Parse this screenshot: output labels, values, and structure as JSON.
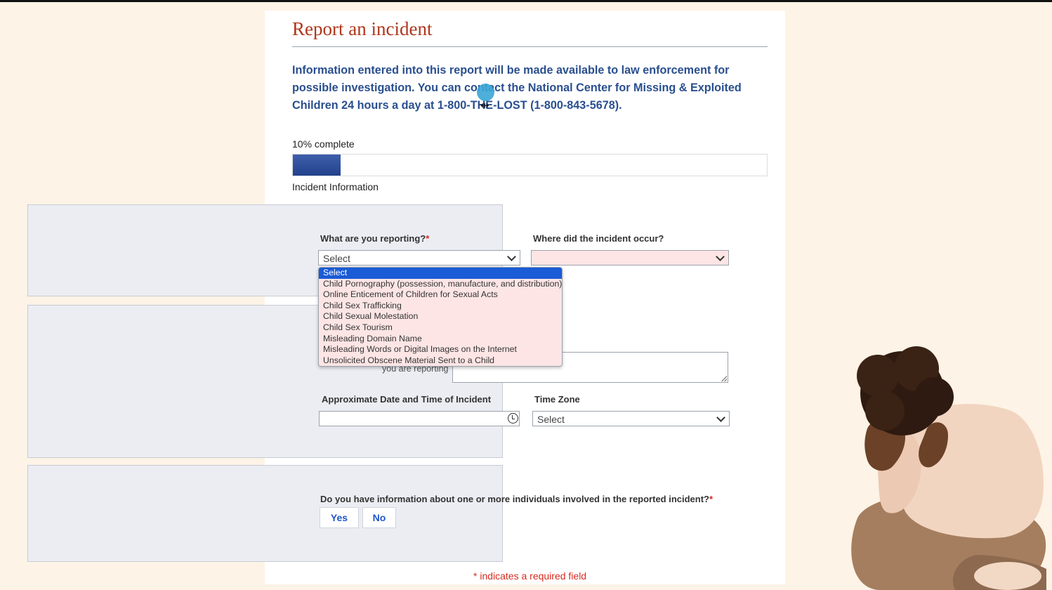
{
  "page": {
    "title": "Report an incident",
    "notice": "Information entered into this report will be made available to law enforcement for possible investigation. You can contact the National Center for Missing & Exploited Children 24 hours a day at 1-800-THE-LOST (1-800-843-5678).",
    "progress_label": "10% complete",
    "progress_percent": 10,
    "section_label": "Incident Information"
  },
  "incident_panel": {
    "reporting_label": "What are you reporting?",
    "reporting_value": "Select",
    "location_label": "Where did the incident occur?",
    "location_value": "",
    "required_mark": "*"
  },
  "reporting_dropdown": {
    "options": [
      "Select",
      "Child Pornography (possession, manufacture, and distribution)",
      "Online Enticement of Children for Sexual Acts",
      "Child Sex Trafficking",
      "Child Sexual Molestation",
      "Child Sex Tourism",
      "Misleading Domain Name",
      "Misleading Words or Digital Images on the Internet",
      "Unsolicited Obscene Material Sent to a Child"
    ],
    "selected_index": 0
  },
  "details_panel": {
    "partial_label": "you are reporting",
    "datetime_label": "Approximate Date and Time of Incident",
    "datetime_value": "",
    "timezone_label": "Time Zone",
    "timezone_value": "Select"
  },
  "individuals_panel": {
    "question": "Do you have information about one or more individuals involved in the reported incident?",
    "required_mark": "*",
    "yes_label": "Yes",
    "no_label": "No"
  },
  "footer": {
    "required_note": "* indicates a required field"
  },
  "colors": {
    "background": "#fdf3e6",
    "title": "#b0361c",
    "notice_text": "#2a4f8f",
    "progress_fill": "#2d4d9b",
    "panel": "#ecedf3",
    "required": "#d62b1f",
    "option_selected": "#1a5bd6",
    "dropdown_bg": "#fde5e5"
  },
  "icons": {
    "select_arrow": "chevron-down-icon",
    "clock": "clock-icon",
    "cursor": "resize-cursor-icon"
  }
}
